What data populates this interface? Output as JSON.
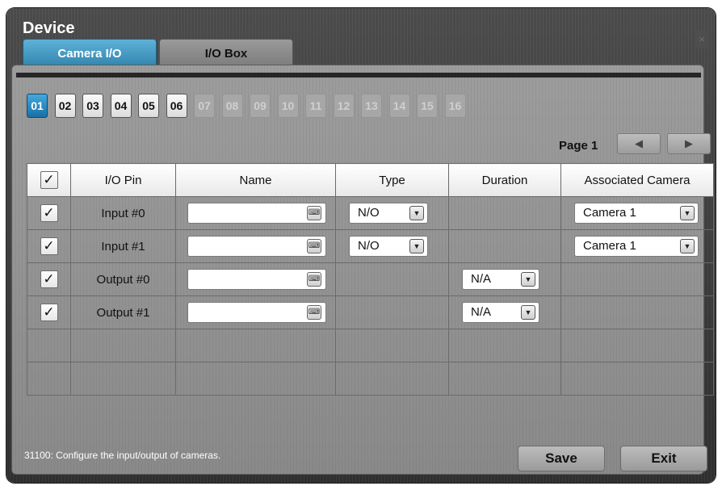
{
  "window": {
    "title": "Device",
    "close_glyph": "×"
  },
  "tabs": [
    {
      "label": "Camera I/O",
      "active": true
    },
    {
      "label": "I/O Box",
      "active": false
    }
  ],
  "pages": [
    {
      "label": "01",
      "state": "selected"
    },
    {
      "label": "02",
      "state": "enabled"
    },
    {
      "label": "03",
      "state": "enabled"
    },
    {
      "label": "04",
      "state": "enabled"
    },
    {
      "label": "05",
      "state": "enabled"
    },
    {
      "label": "06",
      "state": "enabled"
    },
    {
      "label": "07",
      "state": "disabled"
    },
    {
      "label": "08",
      "state": "disabled"
    },
    {
      "label": "09",
      "state": "disabled"
    },
    {
      "label": "10",
      "state": "disabled"
    },
    {
      "label": "11",
      "state": "disabled"
    },
    {
      "label": "12",
      "state": "disabled"
    },
    {
      "label": "13",
      "state": "disabled"
    },
    {
      "label": "14",
      "state": "disabled"
    },
    {
      "label": "15",
      "state": "disabled"
    },
    {
      "label": "16",
      "state": "disabled"
    }
  ],
  "pager": {
    "label": "Page 1",
    "prev_icon": "◀",
    "next_icon": "▶"
  },
  "table": {
    "headers": [
      "I/O Pin",
      "Name",
      "Type",
      "Duration",
      "Associated Camera"
    ],
    "header_checked": "✓",
    "rows": [
      {
        "checked": "✓",
        "pin": "Input #0",
        "name": "",
        "type": "N/O",
        "duration": "",
        "camera": "Camera 1"
      },
      {
        "checked": "✓",
        "pin": "Input #1",
        "name": "",
        "type": "N/O",
        "duration": "",
        "camera": "Camera 1"
      },
      {
        "checked": "✓",
        "pin": "Output #0",
        "name": "",
        "type": "",
        "duration": "N/A",
        "camera": ""
      },
      {
        "checked": "✓",
        "pin": "Output #1",
        "name": "",
        "type": "",
        "duration": "N/A",
        "camera": ""
      }
    ],
    "empty_rows": 2
  },
  "icons": {
    "keyboard": "keyboard-icon",
    "dropdown": "▼"
  },
  "status_text": "31100: Configure the input/output of cameras.",
  "buttons": {
    "save": "Save",
    "exit": "Exit"
  }
}
